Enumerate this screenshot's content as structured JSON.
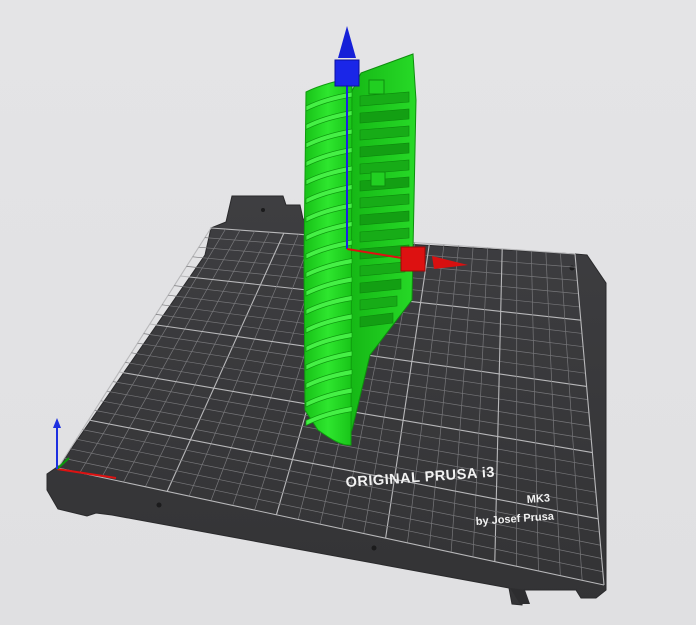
{
  "viewport": {
    "background": "#e3e3e5"
  },
  "bed": {
    "logo_line1": "ORIGINAL PRUSA i3",
    "logo_model": "MK3",
    "logo_line2": "by Josef Prusa",
    "plate_color": "#3a3a3c",
    "grid_color": "#8e8e90"
  },
  "model": {
    "color": "#1fd41f"
  },
  "gizmo": {
    "x_color": "#e01010",
    "y_color": "#0a9a0a",
    "z_color": "#0a10d0",
    "icons": [
      "move-x-arrow",
      "move-z-arrow",
      "scale-x-handle",
      "scale-z-handle"
    ]
  },
  "origin_axes": {
    "icons": [
      "x-axis",
      "y-axis",
      "z-axis"
    ]
  }
}
